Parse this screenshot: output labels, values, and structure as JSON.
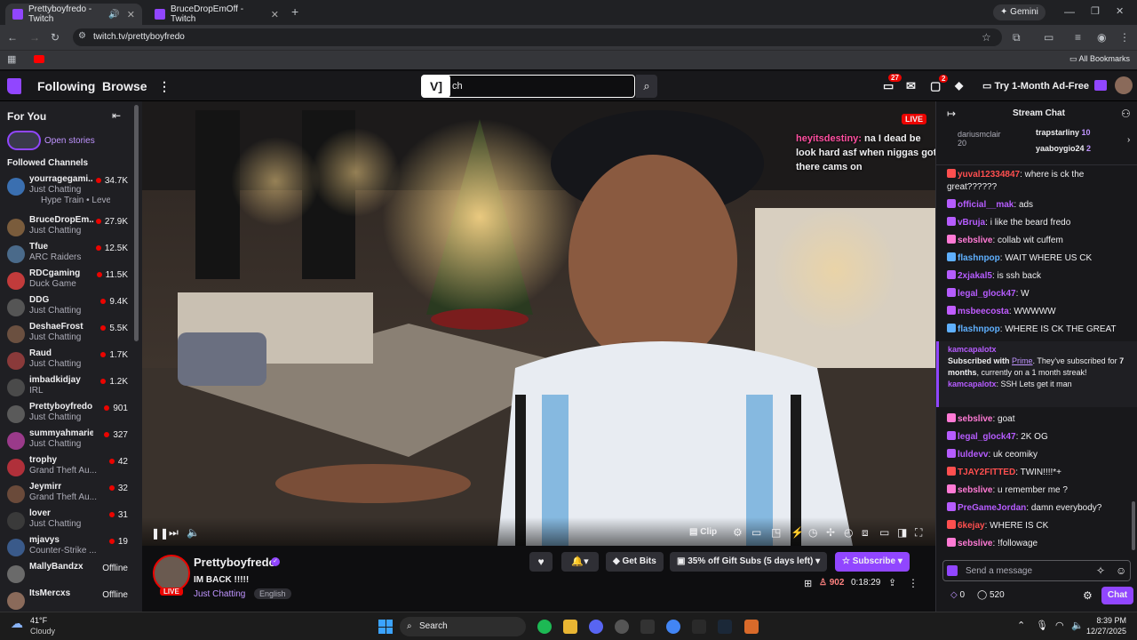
{
  "browser": {
    "tabs": [
      {
        "title": "Prettyboyfredo - Twitch"
      },
      {
        "title": "BruceDropEmOff - Twitch"
      }
    ],
    "gemini_label": "Gemini",
    "url": "twitch.tv/prettyboyfredo",
    "all_bookmarks": "All Bookmarks"
  },
  "nav": {
    "following": "Following",
    "browse": "Browse",
    "search_text": "ch",
    "notif_badge": "27",
    "whisper_badge": "2",
    "ad_free": "Try 1-Month Ad-Free"
  },
  "sidebar": {
    "for_you": "For You",
    "open_stories": "Open stories",
    "followed_header": "Followed Channels",
    "channels": [
      {
        "name": "yourragegami...",
        "game": "Just Chatting",
        "viewers": "34.7K",
        "extra": "Hype Train • Level 11",
        "color": "#3a6fb0"
      },
      {
        "name": "BruceDropEm...",
        "game": "Just Chatting",
        "viewers": "27.9K",
        "color": "#7a5c3c"
      },
      {
        "name": "Tfue",
        "game": "ARC Raiders",
        "viewers": "12.5K",
        "color": "#4a6a8a"
      },
      {
        "name": "RDCgaming",
        "game": "Duck Game",
        "viewers": "11.5K",
        "color": "#c23b3b"
      },
      {
        "name": "DDG",
        "game": "Just Chatting",
        "viewers": "9.4K",
        "color": "#555"
      },
      {
        "name": "DeshaeFrost",
        "game": "Just Chatting",
        "viewers": "5.5K",
        "color": "#6b5040"
      },
      {
        "name": "Raud",
        "game": "Just Chatting",
        "viewers": "1.7K",
        "color": "#8a3a3a"
      },
      {
        "name": "imbadkidjay",
        "game": "IRL",
        "viewers": "1.2K",
        "color": "#4a4a4a"
      },
      {
        "name": "Prettyboyfredo",
        "game": "Just Chatting",
        "viewers": "901",
        "color": "#5a5a5a"
      },
      {
        "name": "summyahmarie",
        "game": "Just Chatting",
        "viewers": "327",
        "color": "#9a3a8a"
      },
      {
        "name": "trophy",
        "game": "Grand Theft Au...",
        "viewers": "42",
        "color": "#b0303a"
      },
      {
        "name": "Jeymirr",
        "game": "Grand Theft Au...",
        "viewers": "32",
        "color": "#6a4a3a"
      },
      {
        "name": "lover",
        "game": "Just Chatting",
        "viewers": "31",
        "color": "#3a3a3a"
      },
      {
        "name": "mjavys",
        "game": "Counter-Strike ...",
        "viewers": "19",
        "color": "#3a5a8a"
      },
      {
        "name": "MallyBandzx",
        "game": "",
        "viewers": "Offline",
        "color": "#6a6a6a"
      },
      {
        "name": "ItsMercxs",
        "game": "",
        "viewers": "Offline",
        "color": "#8a6a5a"
      }
    ]
  },
  "video": {
    "live_badge": "LIVE",
    "overlay_user": "heyitsdestiny:",
    "overlay_text": "na I dead be look hard asf when niggas got there cams on",
    "clip_label": "Clip"
  },
  "stream": {
    "channel": "Prettyboyfredo",
    "title": "IM BACK !!!!!",
    "category": "Just Chatting",
    "tag": "English",
    "live": "LIVE",
    "get_bits": "Get Bits",
    "gift_subs": "35% off Gift Subs (5 days left)",
    "subscribe": "Subscribe",
    "viewers": "902",
    "uptime": "0:18:29"
  },
  "chat": {
    "header": "Stream Chat",
    "leaders": [
      {
        "name": "trapstarliny",
        "count": "10"
      },
      {
        "name": "yaaboygio24",
        "count": "2"
      }
    ],
    "leader_partial": "dariusmclair",
    "leader_partial_count": "20",
    "messages": [
      {
        "user": "yuval12334847",
        "text": "where is ck the great??????",
        "color": "#ff4f4f"
      },
      {
        "user": "official__mak",
        "text": "ads",
        "color": "#b65cff"
      },
      {
        "user": "vBruja",
        "text": "i like the beard fredo",
        "color": "#b65cff"
      },
      {
        "user": "sebslive",
        "text": "collab wit cuffem",
        "color": "#ff7ad5"
      },
      {
        "user": "flashnpop",
        "text": "WAIT WHERE US CK",
        "color": "#5fb0ff"
      },
      {
        "user": "2xjakal5",
        "text": "is ssh back",
        "color": "#b65cff"
      },
      {
        "user": "legal_glock47",
        "text": "W",
        "color": "#b65cff"
      },
      {
        "user": "msbeecosta",
        "text": "WWWWW",
        "color": "#c05cff"
      },
      {
        "user": "flashnpop",
        "text": "WHERE IS CK THE GREAT",
        "color": "#5fb0ff"
      }
    ],
    "sub_notice": {
      "user": "kamcapalotx",
      "text1": "Subscribed with",
      "prime": "Prime",
      "text2": ". They've subscribed for",
      "months": "7 months",
      "text3": ", currently on a 1 month streak!",
      "msg_user": "kamcapalotx",
      "msg_text": "SSH Lets get it man"
    },
    "messages2": [
      {
        "user": "sebslive",
        "text": "goat",
        "color": "#ff7ad5"
      },
      {
        "user": "legal_glock47",
        "text": "2K OG",
        "color": "#b65cff"
      },
      {
        "user": "luldevv",
        "text": "uk ceomiky",
        "color": "#b65cff"
      },
      {
        "user": "TJAY2FITTED",
        "text": "TWIN!!!!*+",
        "color": "#ff4f4f"
      },
      {
        "user": "sebslive",
        "text": "u remember me ?",
        "color": "#ff7ad5"
      },
      {
        "user": "PreGameJordan",
        "text": "damn everybody?",
        "color": "#b65cff"
      },
      {
        "user": "6kejay",
        "text": "WHERE IS CK",
        "color": "#ff4f4f"
      },
      {
        "user": "sebslive",
        "text": "!followage",
        "color": "#ff7ad5"
      }
    ],
    "placeholder": "Send a message",
    "bits": "0",
    "points": "520",
    "chat_button": "Chat"
  },
  "taskbar": {
    "temp": "41°F",
    "weather": "Cloudy",
    "search": "Search",
    "time": "8:39 PM",
    "date": "12/27/2025"
  }
}
